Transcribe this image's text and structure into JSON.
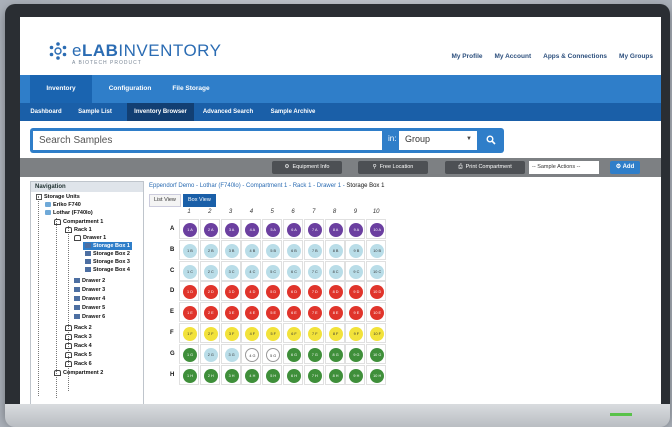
{
  "app": {
    "logo_prefix": "e",
    "logo_bold": "LAB",
    "logo_rest": "INVENTORY",
    "logo_sub": "A BIOTECH PRODUCT"
  },
  "top_links": [
    "My Profile",
    "My Account",
    "Apps & Connections",
    "My Groups"
  ],
  "nav_primary": [
    "Inventory",
    "Configuration",
    "File Storage"
  ],
  "nav_secondary": [
    "Dashboard",
    "Sample List",
    "Inventory Browser",
    "Advanced Search",
    "Sample Archive"
  ],
  "search": {
    "placeholder": "Search Samples",
    "in_label": "in:",
    "scope": "Group"
  },
  "toolbar": {
    "equipment_info": "Equipment Info",
    "free_location": "Free Location",
    "print_compartment": "Print Compartment",
    "sample_actions": "-- Sample Actions --",
    "add": "Add"
  },
  "tree": {
    "header": "Navigation",
    "items": [
      "Storage Units",
      "Eriko F740",
      "Lothar (F740lo)",
      "Compartment 1",
      "Rack 1",
      "Drawer 1",
      "Storage Box 1",
      "Storage Box 2",
      "Storage Box 3",
      "Storage Box 4",
      "Drawer 2",
      "Drawer 3",
      "Drawer 4",
      "Drawer 5",
      "Drawer 6",
      "Rack 2",
      "Rack 3",
      "Rack 4",
      "Rack 5",
      "Rack 6",
      "Compartment 2"
    ]
  },
  "breadcrumb": {
    "path": "Eppendorf Demo - Lothar (F740lo) - Compartment 1 - Rack 1 - Drawer 1 - ",
    "current": "Storage Box 1"
  },
  "view_tabs": [
    "List View",
    "Box View"
  ],
  "box": {
    "columns": [
      "1",
      "2",
      "3",
      "4",
      "5",
      "6",
      "7",
      "8",
      "9",
      "10"
    ],
    "rows": [
      "A",
      "B",
      "C",
      "D",
      "E",
      "F",
      "G",
      "H"
    ],
    "row_colors": {
      "A": "#6b3fa0",
      "B": "#b9dde8",
      "C": "#b9dde8",
      "D": "#e0342b",
      "E": "#e0342b",
      "F": "#f2e23a",
      "G": "#3f8f3a",
      "H": "#3f8f3a"
    },
    "row_g_colors": [
      "#3f8f3a",
      "#b9dde8",
      "#b9dde8",
      "#ffffff",
      "#ffffff",
      "#3f8f3a",
      "#3f8f3a",
      "#3f8f3a",
      "#3f8f3a",
      "#3f8f3a"
    ],
    "samples": {
      "A": [
        "1 A",
        "2 A",
        "3 A",
        "4 A",
        "5 A",
        "6 A",
        "7 A",
        "8 A",
        "9 A",
        "10 A"
      ],
      "B": [
        "1 B",
        "2 B",
        "3 B",
        "4 B",
        "5 B",
        "6 B",
        "7 B",
        "8 B",
        "9 B",
        "10 B"
      ],
      "C": [
        "1 C",
        "2 C",
        "3 C",
        "4 C",
        "5 C",
        "6 C",
        "7 C",
        "8 C",
        "9 C",
        "10 C"
      ],
      "D": [
        "1 D",
        "2 D",
        "3 D",
        "4 D",
        "5 D",
        "6 D",
        "7 D",
        "8 D",
        "9 D",
        "10 D"
      ],
      "E": [
        "1 E",
        "2 E",
        "3 E",
        "4 E",
        "5 E",
        "6 E",
        "7 E",
        "8 E",
        "9 E",
        "10 E"
      ],
      "F": [
        "1 F",
        "2 F",
        "3 F",
        "4 F",
        "5 F",
        "6 F",
        "7 F",
        "8 F",
        "9 F",
        "10 F"
      ],
      "G": [
        "1 G",
        "2 G",
        "3 G",
        "4 G",
        "5 G",
        "6 G",
        "7 G",
        "8 G",
        "9 G",
        "10 G"
      ],
      "H": [
        "1 H",
        "2 H",
        "3 H",
        "4 H",
        "5 H",
        "6 H",
        "7 H",
        "8 H",
        "9 H",
        "10 H"
      ]
    }
  }
}
